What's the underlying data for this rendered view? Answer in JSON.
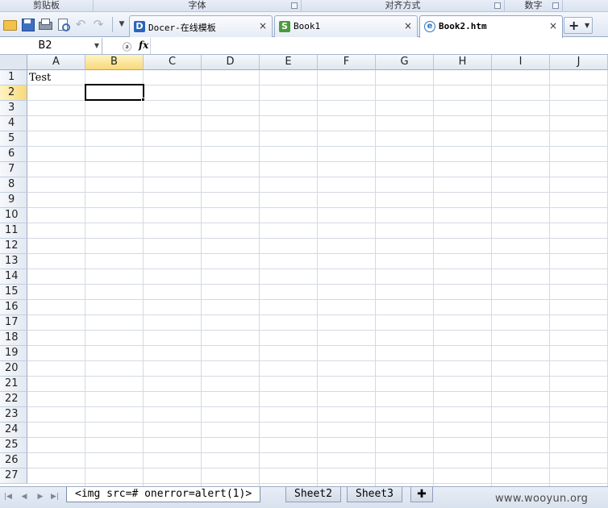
{
  "ribbon": {
    "groups": [
      {
        "label": "剪贴板",
        "launcher": false
      },
      {
        "label": "字体",
        "launcher": true
      },
      {
        "label": "对齐方式",
        "launcher": true
      },
      {
        "label": "数字",
        "launcher": true
      }
    ]
  },
  "quick_access": {
    "icons": [
      "open-folder-icon",
      "save-icon",
      "print-icon",
      "print-preview-icon",
      "undo-icon",
      "redo-icon",
      "customize-dropdown-icon"
    ]
  },
  "doc_tabs": [
    {
      "label": "Docer-在线模板",
      "icon": "D",
      "close": "×",
      "active": false
    },
    {
      "label": "Book1",
      "icon": "S",
      "close": "×",
      "active": false
    },
    {
      "label": "Book2.htm",
      "icon": "e",
      "close": "×",
      "active": true
    }
  ],
  "formula_bar": {
    "cell_ref": "B2",
    "fx_label": "fx",
    "find_label": "ⓐ",
    "value": ""
  },
  "sheet": {
    "columns": [
      "A",
      "B",
      "C",
      "D",
      "E",
      "F",
      "G",
      "H",
      "I",
      "J"
    ],
    "selected_column": "B",
    "rows": [
      "1",
      "2",
      "3",
      "4",
      "5",
      "6",
      "7",
      "8",
      "9",
      "10",
      "11",
      "12",
      "13",
      "14",
      "15",
      "16",
      "17",
      "18",
      "19",
      "20",
      "21",
      "22",
      "23",
      "24",
      "25",
      "26",
      "27"
    ],
    "selected_row": "2",
    "cells": {
      "A1": "Test"
    }
  },
  "sheet_tabs": [
    {
      "label": "<img src=# onerror=alert(1)>",
      "active": true
    },
    {
      "label": "Sheet2",
      "active": false
    },
    {
      "label": "Sheet3",
      "active": false
    }
  ],
  "add_sheet_label": "✚",
  "watermark": "www.wooyun.org"
}
